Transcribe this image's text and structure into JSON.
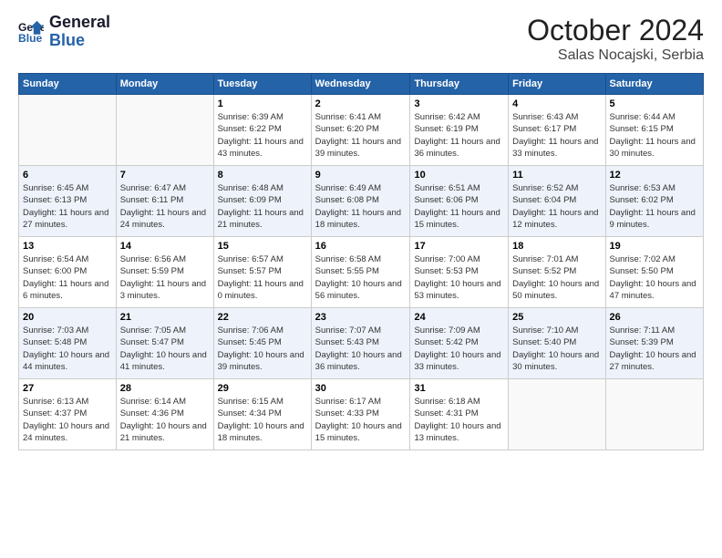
{
  "header": {
    "logo_line1": "General",
    "logo_line2": "Blue",
    "month": "October 2024",
    "location": "Salas Nocajski, Serbia"
  },
  "weekdays": [
    "Sunday",
    "Monday",
    "Tuesday",
    "Wednesday",
    "Thursday",
    "Friday",
    "Saturday"
  ],
  "weeks": [
    [
      {
        "day": "",
        "info": ""
      },
      {
        "day": "",
        "info": ""
      },
      {
        "day": "1",
        "info": "Sunrise: 6:39 AM\nSunset: 6:22 PM\nDaylight: 11 hours and 43 minutes."
      },
      {
        "day": "2",
        "info": "Sunrise: 6:41 AM\nSunset: 6:20 PM\nDaylight: 11 hours and 39 minutes."
      },
      {
        "day": "3",
        "info": "Sunrise: 6:42 AM\nSunset: 6:19 PM\nDaylight: 11 hours and 36 minutes."
      },
      {
        "day": "4",
        "info": "Sunrise: 6:43 AM\nSunset: 6:17 PM\nDaylight: 11 hours and 33 minutes."
      },
      {
        "day": "5",
        "info": "Sunrise: 6:44 AM\nSunset: 6:15 PM\nDaylight: 11 hours and 30 minutes."
      }
    ],
    [
      {
        "day": "6",
        "info": "Sunrise: 6:45 AM\nSunset: 6:13 PM\nDaylight: 11 hours and 27 minutes."
      },
      {
        "day": "7",
        "info": "Sunrise: 6:47 AM\nSunset: 6:11 PM\nDaylight: 11 hours and 24 minutes."
      },
      {
        "day": "8",
        "info": "Sunrise: 6:48 AM\nSunset: 6:09 PM\nDaylight: 11 hours and 21 minutes."
      },
      {
        "day": "9",
        "info": "Sunrise: 6:49 AM\nSunset: 6:08 PM\nDaylight: 11 hours and 18 minutes."
      },
      {
        "day": "10",
        "info": "Sunrise: 6:51 AM\nSunset: 6:06 PM\nDaylight: 11 hours and 15 minutes."
      },
      {
        "day": "11",
        "info": "Sunrise: 6:52 AM\nSunset: 6:04 PM\nDaylight: 11 hours and 12 minutes."
      },
      {
        "day": "12",
        "info": "Sunrise: 6:53 AM\nSunset: 6:02 PM\nDaylight: 11 hours and 9 minutes."
      }
    ],
    [
      {
        "day": "13",
        "info": "Sunrise: 6:54 AM\nSunset: 6:00 PM\nDaylight: 11 hours and 6 minutes."
      },
      {
        "day": "14",
        "info": "Sunrise: 6:56 AM\nSunset: 5:59 PM\nDaylight: 11 hours and 3 minutes."
      },
      {
        "day": "15",
        "info": "Sunrise: 6:57 AM\nSunset: 5:57 PM\nDaylight: 11 hours and 0 minutes."
      },
      {
        "day": "16",
        "info": "Sunrise: 6:58 AM\nSunset: 5:55 PM\nDaylight: 10 hours and 56 minutes."
      },
      {
        "day": "17",
        "info": "Sunrise: 7:00 AM\nSunset: 5:53 PM\nDaylight: 10 hours and 53 minutes."
      },
      {
        "day": "18",
        "info": "Sunrise: 7:01 AM\nSunset: 5:52 PM\nDaylight: 10 hours and 50 minutes."
      },
      {
        "day": "19",
        "info": "Sunrise: 7:02 AM\nSunset: 5:50 PM\nDaylight: 10 hours and 47 minutes."
      }
    ],
    [
      {
        "day": "20",
        "info": "Sunrise: 7:03 AM\nSunset: 5:48 PM\nDaylight: 10 hours and 44 minutes."
      },
      {
        "day": "21",
        "info": "Sunrise: 7:05 AM\nSunset: 5:47 PM\nDaylight: 10 hours and 41 minutes."
      },
      {
        "day": "22",
        "info": "Sunrise: 7:06 AM\nSunset: 5:45 PM\nDaylight: 10 hours and 39 minutes."
      },
      {
        "day": "23",
        "info": "Sunrise: 7:07 AM\nSunset: 5:43 PM\nDaylight: 10 hours and 36 minutes."
      },
      {
        "day": "24",
        "info": "Sunrise: 7:09 AM\nSunset: 5:42 PM\nDaylight: 10 hours and 33 minutes."
      },
      {
        "day": "25",
        "info": "Sunrise: 7:10 AM\nSunset: 5:40 PM\nDaylight: 10 hours and 30 minutes."
      },
      {
        "day": "26",
        "info": "Sunrise: 7:11 AM\nSunset: 5:39 PM\nDaylight: 10 hours and 27 minutes."
      }
    ],
    [
      {
        "day": "27",
        "info": "Sunrise: 6:13 AM\nSunset: 4:37 PM\nDaylight: 10 hours and 24 minutes."
      },
      {
        "day": "28",
        "info": "Sunrise: 6:14 AM\nSunset: 4:36 PM\nDaylight: 10 hours and 21 minutes."
      },
      {
        "day": "29",
        "info": "Sunrise: 6:15 AM\nSunset: 4:34 PM\nDaylight: 10 hours and 18 minutes."
      },
      {
        "day": "30",
        "info": "Sunrise: 6:17 AM\nSunset: 4:33 PM\nDaylight: 10 hours and 15 minutes."
      },
      {
        "day": "31",
        "info": "Sunrise: 6:18 AM\nSunset: 4:31 PM\nDaylight: 10 hours and 13 minutes."
      },
      {
        "day": "",
        "info": ""
      },
      {
        "day": "",
        "info": ""
      }
    ]
  ]
}
